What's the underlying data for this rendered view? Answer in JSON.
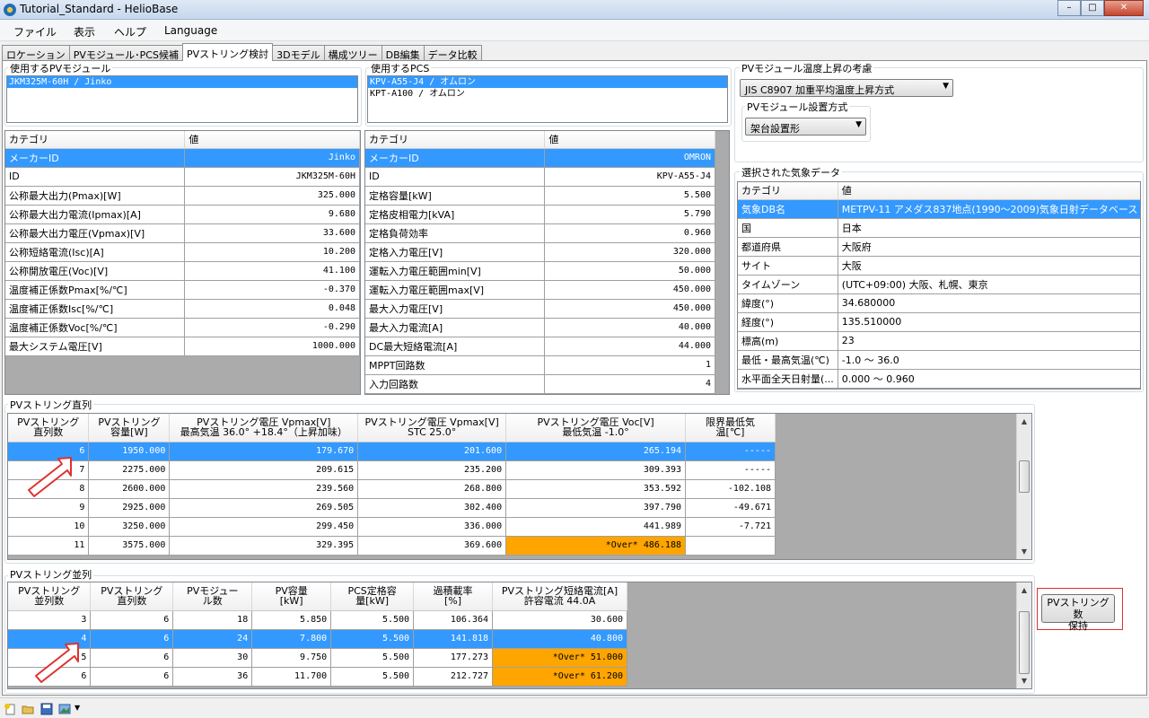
{
  "window": {
    "title": "Tutorial_Standard - HelioBase",
    "min": "–",
    "max": "□",
    "close": "✕"
  },
  "menu": [
    "ファイル",
    "表示",
    "ヘルプ",
    "Language"
  ],
  "tabs": [
    "ロケーション",
    "PVモジュール･PCS候補",
    "PVストリング検討",
    "3Dモデル",
    "構成ツリー",
    "DB編集",
    "データ比較"
  ],
  "active_tab": "PVストリング検討",
  "pv_module": {
    "label": "使用するPVモジュール",
    "items": [
      "JKM325M-60H / Jinko"
    ],
    "grid_headers": [
      "カテゴリ",
      "値"
    ],
    "rows": [
      [
        "メーカーID",
        "Jinko"
      ],
      [
        "ID",
        "JKM325M-60H"
      ],
      [
        "公称最大出力(Pmax)[W]",
        "325.000"
      ],
      [
        "公称最大出力電流(Ipmax)[A]",
        "9.680"
      ],
      [
        "公称最大出力電圧(Vpmax)[V]",
        "33.600"
      ],
      [
        "公称短絡電流(Isc)[A]",
        "10.200"
      ],
      [
        "公称開放電圧(Voc)[V]",
        "41.100"
      ],
      [
        "温度補正係数Pmax[%/℃]",
        "-0.370"
      ],
      [
        "温度補正係数Isc[%/℃]",
        "0.048"
      ],
      [
        "温度補正係数Voc[%/℃]",
        "-0.290"
      ],
      [
        "最大システム電圧[V]",
        "1000.000"
      ]
    ]
  },
  "pcs": {
    "label": "使用するPCS",
    "items": [
      "KPV-A55-J4 / オムロン",
      "KPT-A100 / オムロン"
    ],
    "grid_headers": [
      "カテゴリ",
      "値"
    ],
    "rows": [
      [
        "メーカーID",
        "OMRON"
      ],
      [
        "ID",
        "KPV-A55-J4"
      ],
      [
        "定格容量[kW]",
        "5.500"
      ],
      [
        "定格皮相電力[kVA]",
        "5.790"
      ],
      [
        "定格負荷効率",
        "0.960"
      ],
      [
        "定格入力電圧[V]",
        "320.000"
      ],
      [
        "運転入力電圧範囲min[V]",
        "50.000"
      ],
      [
        "運転入力電圧範囲max[V]",
        "450.000"
      ],
      [
        "最大入力電圧[V]",
        "450.000"
      ],
      [
        "最大入力電流[A]",
        "40.000"
      ],
      [
        "DC最大短絡電流[A]",
        "44.000"
      ],
      [
        "MPPT回路数",
        "1"
      ],
      [
        "入力回路数",
        "4"
      ]
    ]
  },
  "temp": {
    "label": "PVモジュール温度上昇の考慮",
    "method": "JIS C8907 加重平均温度上昇方式",
    "install_label": "PVモジュール設置方式",
    "install": "架台設置形"
  },
  "weather": {
    "label": "選択された気象データ",
    "grid_headers": [
      "カテゴリ",
      "値"
    ],
    "rows": [
      [
        "気象DB名",
        "METPV-11 アメダス837地点(1990〜2009)気象日射データベース /..."
      ],
      [
        "国",
        "日本"
      ],
      [
        "都道府県",
        "大阪府"
      ],
      [
        "サイト",
        "大阪"
      ],
      [
        "タイムゾーン",
        "(UTC+09:00) 大阪、札幌、東京"
      ],
      [
        "緯度(°)",
        "34.680000"
      ],
      [
        "経度(°)",
        "135.510000"
      ],
      [
        "標高(m)",
        "23"
      ],
      [
        "最低・最高気温(℃)",
        "-1.0 〜 36.0"
      ],
      [
        "水平面全天日射量(...",
        "0.000 〜 0.960"
      ]
    ]
  },
  "series": {
    "label": "PVストリング直列",
    "headers": [
      "PVストリング\n直列数",
      "PVストリング\n容量[W]",
      "PVストリング電圧 Vpmax[V]\n最高気温 36.0° +18.4°（上昇加味）",
      "PVストリング電圧 Vpmax[V]\nSTC 25.0°",
      "PVストリング電圧 Voc[V]\n最低気温 -1.0°",
      "限界最低気\n温[℃]"
    ],
    "rows": [
      [
        "6",
        "1950.000",
        "179.670",
        "201.600",
        "265.194",
        "-----"
      ],
      [
        "7",
        "2275.000",
        "209.615",
        "235.200",
        "309.393",
        "-----"
      ],
      [
        "8",
        "2600.000",
        "239.560",
        "268.800",
        "353.592",
        "-102.108"
      ],
      [
        "9",
        "2925.000",
        "269.505",
        "302.400",
        "397.790",
        "-49.671"
      ],
      [
        "10",
        "3250.000",
        "299.450",
        "336.000",
        "441.989",
        "-7.721"
      ],
      [
        "11",
        "3575.000",
        "329.395",
        "369.600",
        "*Over* 486.188",
        ""
      ]
    ],
    "selected": 0
  },
  "parallel": {
    "label": "PVストリング並列",
    "headers": [
      "PVストリング\n並列数",
      "PVストリング\n直列数",
      "PVモジュー\nル数",
      "PV容量\n[kW]",
      "PCS定格容\n量[kW]",
      "過積載率\n[%]",
      "PVストリング短絡電流[A]\n許容電流 44.0A"
    ],
    "rows": [
      [
        "3",
        "6",
        "18",
        "5.850",
        "5.500",
        "106.364",
        "30.600"
      ],
      [
        "4",
        "6",
        "24",
        "7.800",
        "5.500",
        "141.818",
        "40.800"
      ],
      [
        "5",
        "6",
        "30",
        "9.750",
        "5.500",
        "177.273",
        "*Over* 51.000"
      ],
      [
        "6",
        "6",
        "36",
        "11.700",
        "5.500",
        "212.727",
        "*Over* 61.200"
      ]
    ],
    "selected": 1
  },
  "keep_button": "PVストリング数\n保持",
  "colors": {
    "selection": "#3399ff",
    "over": "#ffa500",
    "annotation": "#e03030"
  },
  "toolbar_icons": [
    "new-file-icon",
    "open-folder-icon",
    "save-icon",
    "export-image-icon"
  ]
}
